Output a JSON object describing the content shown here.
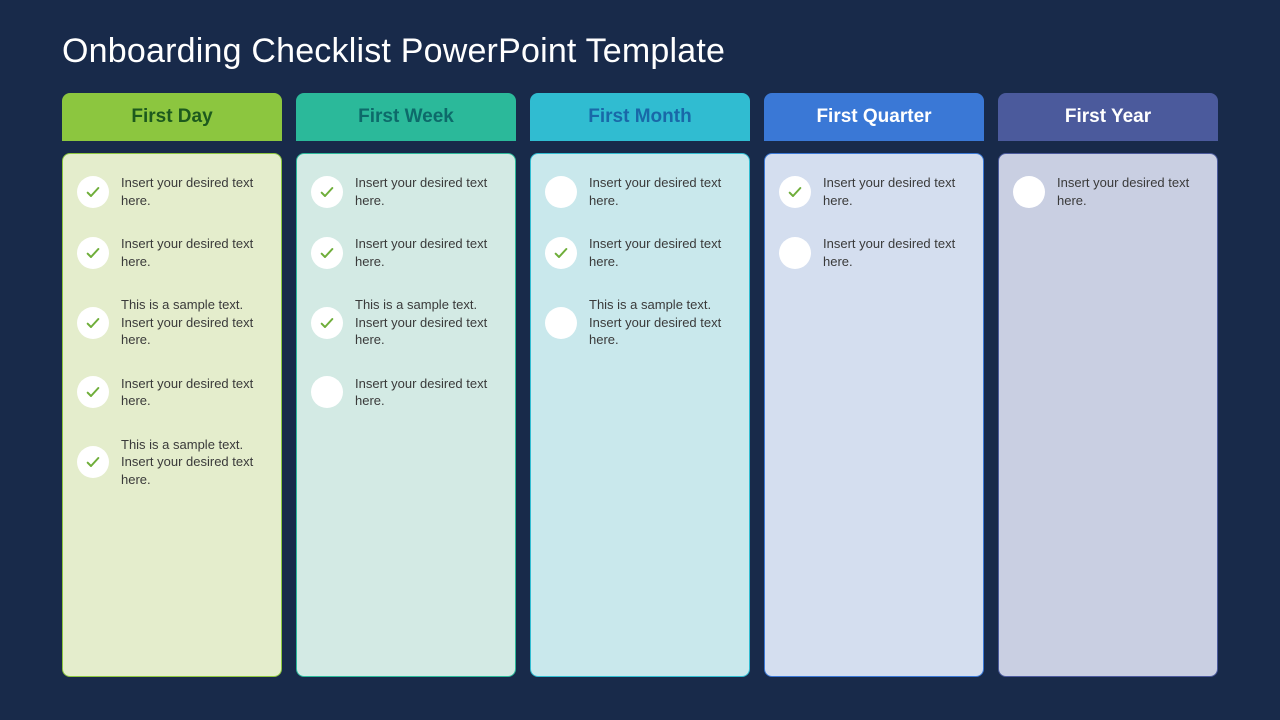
{
  "title": "Onboarding Checklist PowerPoint Template",
  "columns": [
    {
      "label": "First Day",
      "items": [
        {
          "text": "Insert your desired text here.",
          "checked": true
        },
        {
          "text": "Insert your desired text here.",
          "checked": true
        },
        {
          "text": "This is a sample text. Insert your desired text here.",
          "checked": true
        },
        {
          "text": "Insert your desired text here.",
          "checked": true
        },
        {
          "text": "This is a sample text. Insert your desired text here.",
          "checked": true
        }
      ]
    },
    {
      "label": "First Week",
      "items": [
        {
          "text": "Insert your desired text here.",
          "checked": true
        },
        {
          "text": "Insert your desired text here.",
          "checked": true
        },
        {
          "text": "This is a sample text. Insert your desired text here.",
          "checked": true
        },
        {
          "text": "Insert your desired text here.",
          "checked": false
        }
      ]
    },
    {
      "label": "First Month",
      "items": [
        {
          "text": "Insert your desired text here.",
          "checked": false
        },
        {
          "text": "Insert your desired text here.",
          "checked": true
        },
        {
          "text": "This is a sample text. Insert your desired text here.",
          "checked": false
        }
      ]
    },
    {
      "label": "First Quarter",
      "items": [
        {
          "text": "Insert your desired text here.",
          "checked": true
        },
        {
          "text": "Insert your desired text here.",
          "checked": false
        }
      ]
    },
    {
      "label": "First Year",
      "items": [
        {
          "text": "Insert your desired text here.",
          "checked": false
        }
      ]
    }
  ]
}
